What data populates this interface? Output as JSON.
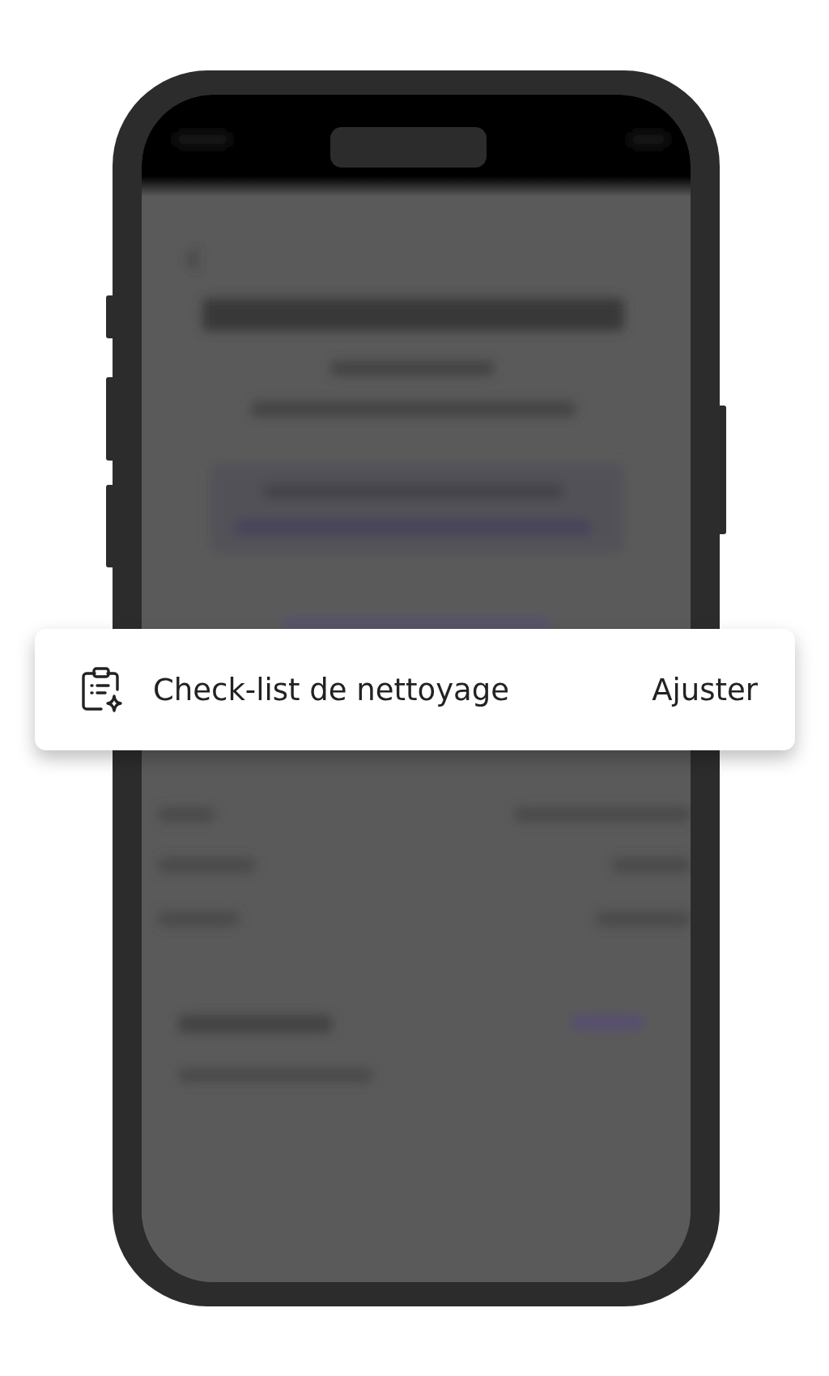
{
  "card": {
    "title": "Check-list de nettoyage",
    "action": "Ajuster"
  }
}
